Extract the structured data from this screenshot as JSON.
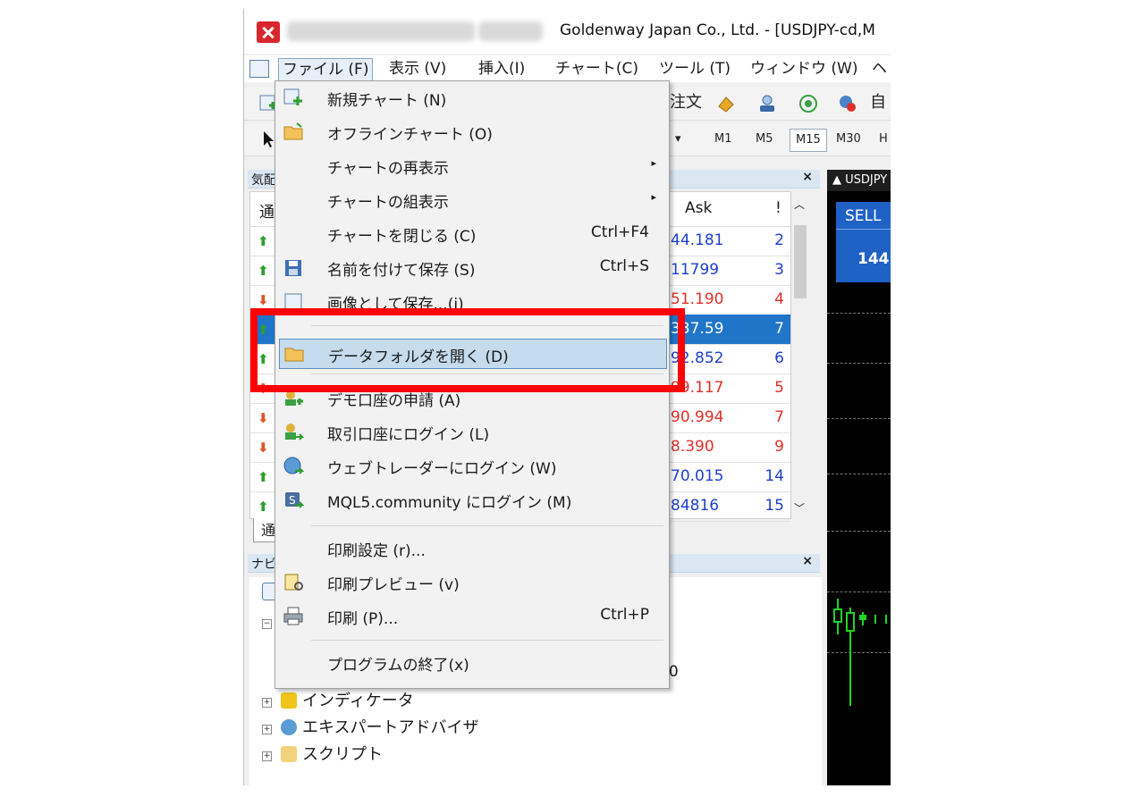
{
  "window": {
    "title": "Goldenway Japan Co., Ltd. - [USDJPY-cd,M"
  },
  "menubar": {
    "items": [
      "ファイル (F)",
      "表示 (V)",
      "挿入(I)",
      "チャート(C)",
      "ツール (T)",
      "ウィンドウ (W)",
      "ヘ"
    ]
  },
  "toolbar": {
    "order_label": "注文",
    "auto_label": "自",
    "timeframes": [
      "M1",
      "M5",
      "M15",
      "M30",
      "H"
    ],
    "selected_timeframe": "M15"
  },
  "market_watch": {
    "header_label": "気配",
    "col_symbol": "通",
    "col_ask": "Ask",
    "col_spread": "!",
    "rows": [
      {
        "dir": "up",
        "ask": "44.181",
        "spread": "2",
        "color": "#1f3fd0"
      },
      {
        "dir": "up",
        "ask": "11799",
        "spread": "3",
        "color": "#1f3fd0"
      },
      {
        "dir": "down",
        "ask": "51.190",
        "spread": "4",
        "color": "#e0302a"
      },
      {
        "dir": "up",
        "ask": "337.59",
        "spread": "7",
        "color": "#ffffff"
      },
      {
        "dir": "up",
        "ask": "92.852",
        "spread": "6",
        "color": "#1f3fd0"
      },
      {
        "dir": "down",
        "ask": "99.117",
        "spread": "5",
        "color": "#e0302a"
      },
      {
        "dir": "down",
        "ask": "90.994",
        "spread": "7",
        "color": "#e0302a"
      },
      {
        "dir": "down",
        "ask": "8.390",
        "spread": "9",
        "color": "#e0302a"
      },
      {
        "dir": "up",
        "ask": "70.015",
        "spread": "14",
        "color": "#1f3fd0"
      },
      {
        "dir": "up",
        "ask": "84816",
        "spread": "15",
        "color": "#1f3fd0"
      }
    ],
    "bottom_tab": "通"
  },
  "chart": {
    "tab_label": "USDJPY",
    "sell_label": "SELL",
    "sell_value": "144"
  },
  "navigator": {
    "header_label": "ナビ",
    "partial_value": "00",
    "items": [
      "インディケータ",
      "エキスパートアドバイザ",
      "スクリプト"
    ]
  },
  "file_menu": {
    "items": [
      {
        "label": "新規チャート (N)",
        "shortcut": "",
        "submenu": false,
        "icon": "new-chart-icon"
      },
      {
        "label": "オフラインチャート (O)",
        "shortcut": "",
        "submenu": false,
        "icon": "open-folder-icon"
      },
      {
        "label": "チャートの再表示",
        "shortcut": "",
        "submenu": true,
        "icon": ""
      },
      {
        "label": "チャートの組表示",
        "shortcut": "",
        "submenu": true,
        "icon": ""
      },
      {
        "label": "チャートを閉じる (C)",
        "shortcut": "Ctrl+F4",
        "submenu": false,
        "icon": ""
      },
      {
        "label": "名前を付けて保存 (S)",
        "shortcut": "Ctrl+S",
        "submenu": false,
        "icon": "save-icon"
      },
      {
        "label": "画像として保存...(i)",
        "shortcut": "",
        "submenu": false,
        "icon": "save-image-icon"
      },
      {
        "label": "データフォルダを開く (D)",
        "shortcut": "",
        "submenu": false,
        "icon": "folder-icon"
      },
      {
        "label": "デモ口座の申請 (A)",
        "shortcut": "",
        "submenu": false,
        "icon": "demo-account-icon"
      },
      {
        "label": "取引口座にログイン (L)",
        "shortcut": "",
        "submenu": false,
        "icon": "login-account-icon"
      },
      {
        "label": "ウェブトレーダーにログイン (W)",
        "shortcut": "",
        "submenu": false,
        "icon": "webtrader-icon"
      },
      {
        "label": "MQL5.community にログイン (M)",
        "shortcut": "",
        "submenu": false,
        "icon": "mql5-icon"
      },
      {
        "label": "印刷設定 (r)...",
        "shortcut": "",
        "submenu": false,
        "icon": ""
      },
      {
        "label": "印刷プレビュー (v)",
        "shortcut": "",
        "submenu": false,
        "icon": "print-preview-icon"
      },
      {
        "label": "印刷 (P)...",
        "shortcut": "Ctrl+P",
        "submenu": false,
        "icon": "print-icon"
      },
      {
        "label": "プログラムの終了(x)",
        "shortcut": "",
        "submenu": false,
        "icon": ""
      }
    ]
  },
  "colors": {
    "highlight_frame": "#ff0000",
    "selected_row": "#1f76c9",
    "up_arrow": "#2e9e2e",
    "down_arrow": "#e0552a"
  }
}
